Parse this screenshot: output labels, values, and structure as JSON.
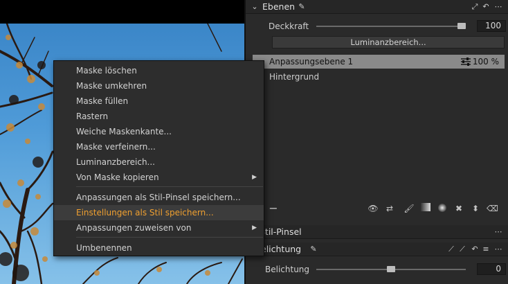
{
  "context_menu": {
    "items": [
      {
        "label": "Maske löschen"
      },
      {
        "label": "Maske umkehren"
      },
      {
        "label": "Maske füllen"
      },
      {
        "label": "Rastern"
      },
      {
        "label": "Weiche Maskenkante..."
      },
      {
        "label": "Maske verfeinern..."
      },
      {
        "label": "Luminanzbereich..."
      },
      {
        "label": "Von Maske kopieren"
      },
      {
        "label": "Anpassungen als Stil-Pinsel speichern..."
      },
      {
        "label": "Einstellungen als Stil speichern..."
      },
      {
        "label": "Anpassungen zuweisen von"
      },
      {
        "label": "Umbenennen"
      }
    ],
    "highlight_color": "#f0a030"
  },
  "layers_panel": {
    "title": "Ebenen",
    "opacity_label": "Deckkraft",
    "opacity_value": "100",
    "opacity_level": 1.0,
    "luminance_button": "Luminanzbereich...",
    "layers": [
      {
        "name": "Anpassungsebene 1",
        "opacity": "100 %",
        "selected": true
      },
      {
        "name": "Hintergrund"
      }
    ]
  },
  "style_brush_panel": {
    "title": "Stil-Pinsel"
  },
  "exposure_panel": {
    "title": "elichtung",
    "row_label": "Belichtung",
    "value": "0",
    "slider_level": 0.5
  },
  "icons": [
    "pencil-icon",
    "eye-icon",
    "swap-icon",
    "brush-icon",
    "gradient-icon",
    "radial-icon",
    "eraser-icon",
    "stamp-icon",
    "ellipsis-icon",
    "reset-icon"
  ]
}
